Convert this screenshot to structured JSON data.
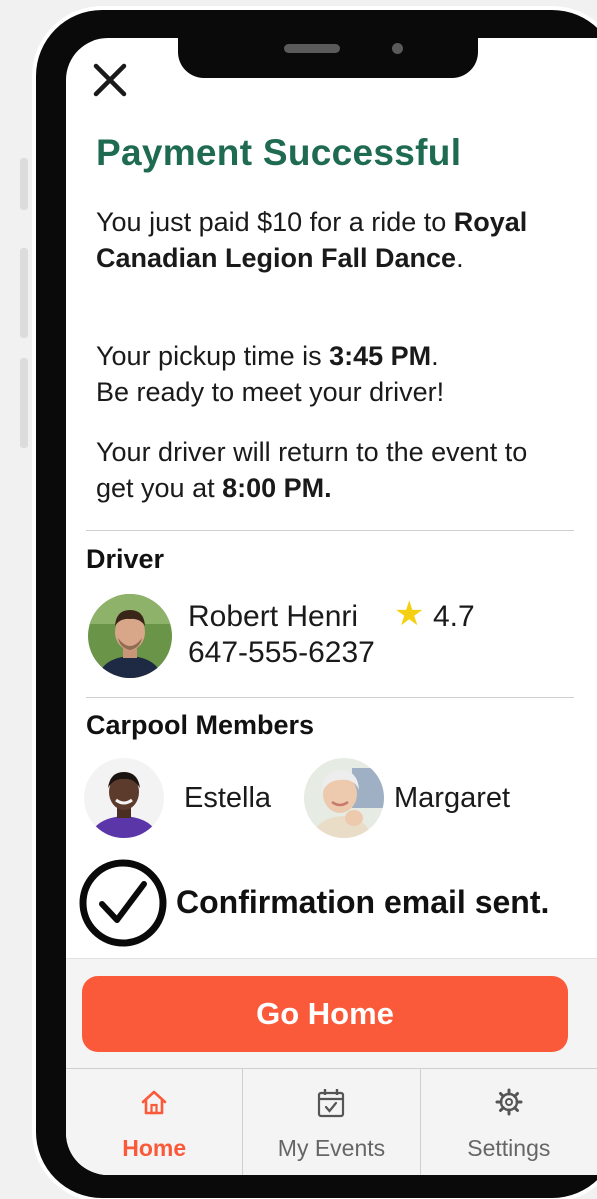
{
  "payment": {
    "title": "Payment Successful",
    "line1_prefix": "You just paid $10 for a ride to ",
    "event_name": "Royal Canadian Legion Fall Dance",
    "line1_suffix": ".",
    "pickup_prefix": "Your pickup time is ",
    "pickup_time": "3:45 PM",
    "pickup_suffix": ".",
    "pickup_line2": "Be ready to meet your driver!",
    "return_prefix": "Your driver will return to the event to get you at ",
    "return_time": "8:00 PM."
  },
  "driver": {
    "heading": "Driver",
    "name": "Robert Henri",
    "rating": "4.7",
    "phone": "647-555-6237"
  },
  "carpool": {
    "heading": "Carpool Members",
    "members": [
      {
        "name": "Estella"
      },
      {
        "name": "Margaret"
      }
    ]
  },
  "confirmation": {
    "text": "Confirmation email sent."
  },
  "actions": {
    "go_home_label": "Go Home"
  },
  "tabs": [
    {
      "label": "Home",
      "icon": "home-icon",
      "active": true
    },
    {
      "label": "My Events",
      "icon": "calendar-check-icon",
      "active": false
    },
    {
      "label": "Settings",
      "icon": "gear-icon",
      "active": false
    }
  ],
  "colors": {
    "accent": "#fa5a3a",
    "title_green": "#1f6b52",
    "star": "#f5cf12"
  }
}
